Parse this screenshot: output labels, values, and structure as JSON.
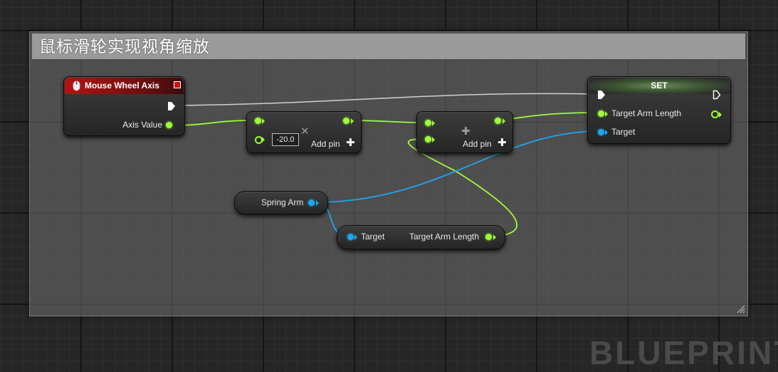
{
  "comment": {
    "title": "鼠标滑轮实现视角缩放"
  },
  "nodes": {
    "mouse_wheel": {
      "title": "Mouse Wheel Axis",
      "output_label": "Axis Value",
      "icon": "mouse-icon"
    },
    "multiply": {
      "value": "-20.0",
      "add_pin_label": "Add pin"
    },
    "add": {
      "add_pin_label": "Add pin"
    },
    "set": {
      "title": "SET",
      "input_label": "Target Arm Length",
      "target_label": "Target"
    },
    "spring_arm": {
      "label": "Spring Arm"
    },
    "get_arm_length": {
      "target_label": "Target",
      "output_label": "Target Arm Length"
    }
  },
  "watermark": "BLUEPRINT",
  "colors": {
    "float_pin": "#9efc3a",
    "object_pin": "#1ea6ee",
    "exec_wire": "#cfcfcf",
    "event_header": "#b31212"
  }
}
